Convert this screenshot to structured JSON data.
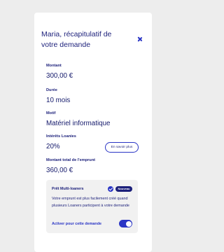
{
  "modal": {
    "title": "Maria, récapitulatif de votre demande",
    "close_icon": "close-icon"
  },
  "fields": [
    {
      "label": "Montant",
      "value": "300,00 €"
    },
    {
      "label": "Durée",
      "value": "10 mois"
    },
    {
      "label": "Motif",
      "value": "Matériel informatique"
    },
    {
      "label": "Intérêts Loanies",
      "value": "20%"
    },
    {
      "label": "Montant total de l'emprunt",
      "value": "360,00 €"
    }
  ],
  "learn_more_button": "En savoir plus",
  "multi_loaners": {
    "title": "Prêt Multi-loaners",
    "badge": "Nouveau",
    "description": "Votre emprunt est plus facilement créé quand plusieurs Loaners participent à votre demande",
    "toggle_label": "Activer pour cette demande",
    "toggle_on": true
  },
  "colors": {
    "accent": "#2a35c5",
    "navy": "#1b1f7a",
    "background": "#ededed"
  }
}
